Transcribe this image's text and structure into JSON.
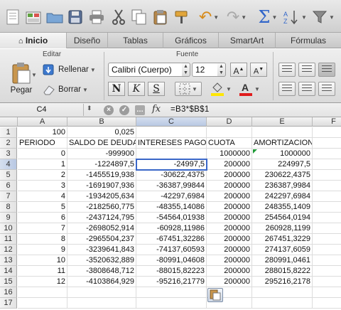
{
  "ribbon": {
    "tabs": [
      {
        "label": "Inicio",
        "icon": "home-icon"
      },
      {
        "label": "Diseño"
      },
      {
        "label": "Tablas"
      },
      {
        "label": "Gráficos"
      },
      {
        "label": "SmartArt"
      },
      {
        "label": "Fórmulas"
      }
    ],
    "group_editar": "Editar",
    "group_fuente": "Fuente",
    "paste_label": "Pegar",
    "fill_label": "Rellenar",
    "clear_label": "Borrar",
    "font_name": "Calibri (Cuerpo)",
    "font_size": "12",
    "bold": "N",
    "italic": "K",
    "underline": "S",
    "highlight_color": "#ffe600",
    "font_color": "#e01c1c"
  },
  "formula_bar": {
    "name_box": "C4",
    "fx": "fx",
    "formula": "=B3*$B$1"
  },
  "sheet": {
    "columns": [
      "A",
      "B",
      "C",
      "D",
      "E",
      "F"
    ],
    "rows": [
      [
        "1",
        "100",
        "0,025",
        "",
        "",
        ""
      ],
      [
        "2",
        "PERIODO",
        "SALDO DE DEUDA",
        "INTERESES PAGOS",
        "CUOTA",
        "AMORTIZACION"
      ],
      [
        "3",
        "0",
        "-999900",
        "",
        "1000000",
        "1000000"
      ],
      [
        "4",
        "1",
        "-1224897,5",
        "-24997,5",
        "200000",
        "224997,5"
      ],
      [
        "5",
        "2",
        "-1455519,938",
        "-30622,4375",
        "200000",
        "230622,4375"
      ],
      [
        "6",
        "3",
        "-1691907,936",
        "-36387,99844",
        "200000",
        "236387,9984"
      ],
      [
        "7",
        "4",
        "-1934205,634",
        "-42297,6984",
        "200000",
        "242297,6984"
      ],
      [
        "8",
        "5",
        "-2182560,775",
        "-48355,14086",
        "200000",
        "248355,1409"
      ],
      [
        "9",
        "6",
        "-2437124,795",
        "-54564,01938",
        "200000",
        "254564,0194"
      ],
      [
        "10",
        "7",
        "-2698052,914",
        "-60928,11986",
        "200000",
        "260928,1199"
      ],
      [
        "11",
        "8",
        "-2965504,237",
        "-67451,32286",
        "200000",
        "267451,3229"
      ],
      [
        "12",
        "9",
        "-3239641,843",
        "-74137,60593",
        "200000",
        "274137,6059"
      ],
      [
        "13",
        "10",
        "-3520632,889",
        "-80991,04608",
        "200000",
        "280991,0461"
      ],
      [
        "14",
        "11",
        "-3808648,712",
        "-88015,82223",
        "200000",
        "288015,8222"
      ],
      [
        "15",
        "12",
        "-4103864,929",
        "-95216,21779",
        "200000",
        "295216,2178"
      ],
      [
        "16",
        "",
        "",
        "",
        "",
        ""
      ],
      [
        "17",
        "",
        "",
        "",
        "",
        ""
      ]
    ],
    "selected_cell": "C4",
    "accent": "#3a67c8"
  }
}
